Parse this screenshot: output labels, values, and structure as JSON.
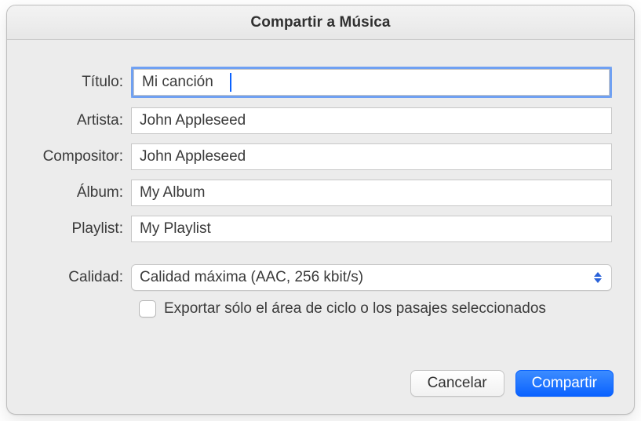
{
  "window": {
    "title": "Compartir a Música"
  },
  "form": {
    "title": {
      "label": "Título:",
      "value": "Mi canción"
    },
    "artist": {
      "label": "Artista:",
      "value": "John Appleseed"
    },
    "composer": {
      "label": "Compositor:",
      "value": "John Appleseed"
    },
    "album": {
      "label": "Álbum:",
      "value": "My Album"
    },
    "playlist": {
      "label": "Playlist:",
      "value": "My Playlist"
    },
    "quality": {
      "label": "Calidad:",
      "value": "Calidad máxima (AAC, 256 kbit/s)"
    },
    "export_selection": {
      "label": "Exportar sólo el área de ciclo o los pasajes seleccionados",
      "checked": false
    }
  },
  "footer": {
    "cancel": "Cancelar",
    "share": "Compartir"
  }
}
